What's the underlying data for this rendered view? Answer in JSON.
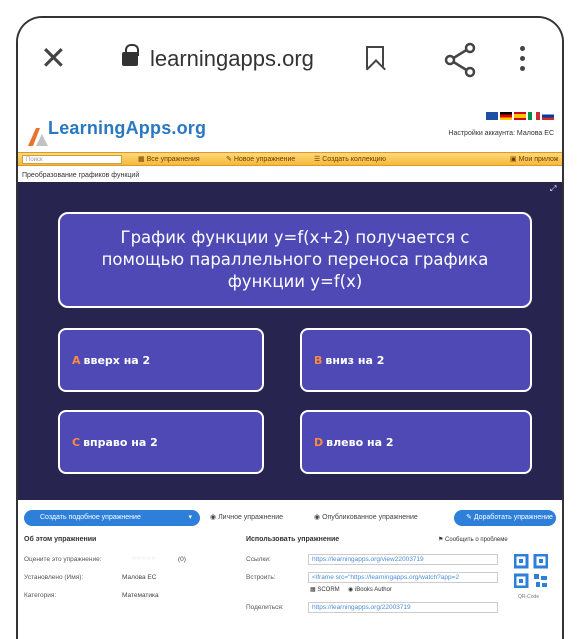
{
  "browser": {
    "url": "learningapps.org"
  },
  "site": {
    "logo_text": "LearningApps.org",
    "account_text": "Настройки аккаунта: Малова ЕС",
    "nav": {
      "search_placeholder": "Поиск",
      "all_exercises": "Все упражнения",
      "new_exercise": "Новое упражнение",
      "create_collection": "Создать коллекцию",
      "my_apps": "Мои прилож"
    },
    "page_title": "Преобразование графиков функций"
  },
  "exercise": {
    "question": "График функции y=f(x+2) получается с помощью параллельного переноса графика функции y=f(x)",
    "answers": [
      {
        "letter": "A",
        "text": "вверх на 2"
      },
      {
        "letter": "B",
        "text": "вниз на 2"
      },
      {
        "letter": "C",
        "text": "вправо на 2"
      },
      {
        "letter": "D",
        "text": "влево на 2"
      }
    ]
  },
  "actions": {
    "create_similar": "Создать подобное упражнение",
    "private": "Личное упражнение",
    "published": "Опубликованное упражнение",
    "improve": "Доработать упражнение"
  },
  "info": {
    "about_heading": "Об этом упражнении",
    "use_heading": "Использовать упражнение",
    "report": "Сообщить о проблеме",
    "rate_label": "Оцените это упражнение:",
    "rate_count": "(0)",
    "installed_label": "Установлено (Имя):",
    "installed_value": "Малова ЕС",
    "category_label": "Категория:",
    "category_value": "Математика",
    "link_label": "Ссылки:",
    "link_value": "https://learningapps.org/view22003719",
    "embed_label": "Встроить:",
    "embed_value": "<iframe src=\"https://learningapps.org/watch?app=2",
    "scorm": "SCORM",
    "ibooks": "iBooks Author",
    "share_label": "Поделиться:",
    "share_value": "https://learningapps.org/22003719",
    "qr_label": "QR-Code"
  },
  "colors": {
    "stage_bg": "#27244f",
    "tile_bg": "#4f49b6",
    "answer_letter": "#ff8a3d",
    "nav_orange": "#f6b93b",
    "button_blue": "#2d7fd9"
  }
}
